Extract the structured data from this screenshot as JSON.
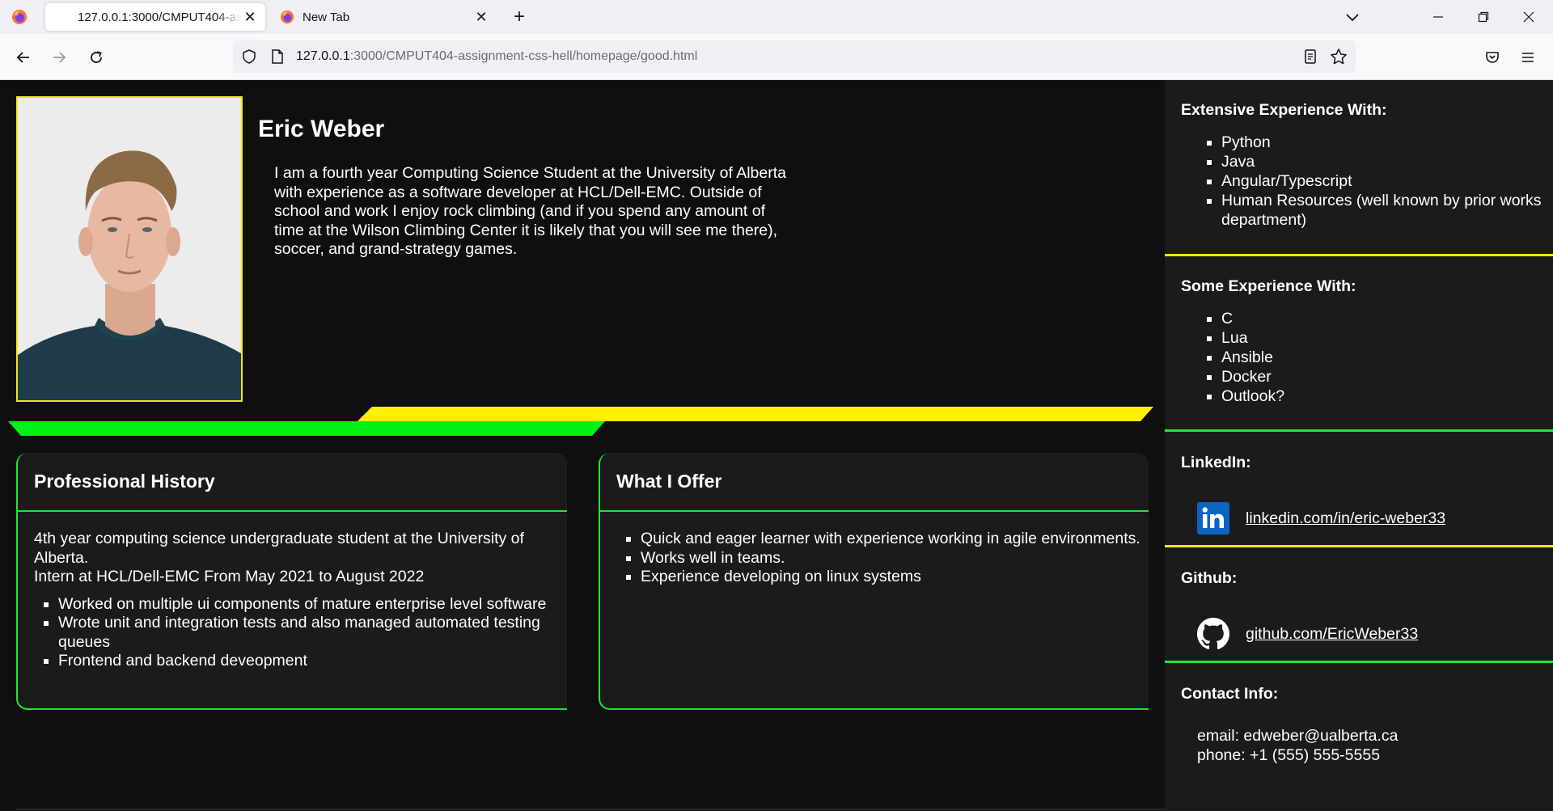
{
  "browser": {
    "tabs": [
      {
        "title": "127.0.0.1:3000/CMPUT404-assignment-css-hell/homepage/good.html",
        "active": true
      },
      {
        "title": "New Tab",
        "active": false
      }
    ],
    "url": {
      "host": "127.0.0.1",
      "path": ":3000/CMPUT404-assignment-css-hell/homepage/good.html"
    }
  },
  "profile": {
    "name": "Eric Weber",
    "bio": "I am a fourth year Computing Science Student at the University of Alberta with experience as a software developer at HCL/Dell-EMC. Outside of school and work I enjoy rock climbing (and if you spend any amount of time at the Wilson Climbing Center it is likely that you will see me there), soccer, and grand-strategy games."
  },
  "history": {
    "title": "Professional History",
    "line1": "4th year computing science undergraduate student at the University of Alberta.",
    "line2": "Intern at HCL/Dell-EMC From May 2021 to August 2022",
    "items": [
      "Worked on multiple ui components of mature enterprise level software",
      "Wrote unit and integration tests and also managed automated testing queues",
      "Frontend and backend deveopment"
    ]
  },
  "offer": {
    "title": "What I Offer",
    "items": [
      "Quick and eager learner with experience working in agile environments.",
      "Works well in teams.",
      "Experience developing on linux systems"
    ]
  },
  "sidebar": {
    "extensive": {
      "title": "Extensive Experience With:",
      "items": [
        "Python",
        "Java",
        "Angular/Typescript",
        "Human Resources (well known by prior works department)"
      ]
    },
    "some": {
      "title": "Some Experience With:",
      "items": [
        "C",
        "Lua",
        "Ansible",
        "Docker",
        "Outlook?"
      ]
    },
    "linkedin": {
      "title": "LinkedIn:",
      "link": "linkedin.com/in/eric-weber33",
      "icon": "linkedin-icon"
    },
    "github": {
      "title": "Github:",
      "link": "github.com/EricWeber33",
      "icon": "github-icon"
    },
    "contact": {
      "title": "Contact Info:",
      "email": "email: edweber@ualberta.ca",
      "phone": "phone: +1 (555) 555-5555"
    }
  },
  "colors": {
    "background": "#0f0f10",
    "card": "#1b1b1c",
    "accent_green": "#22e532",
    "accent_yellow": "#fff200",
    "linkedin_blue": "#0a66c2"
  }
}
